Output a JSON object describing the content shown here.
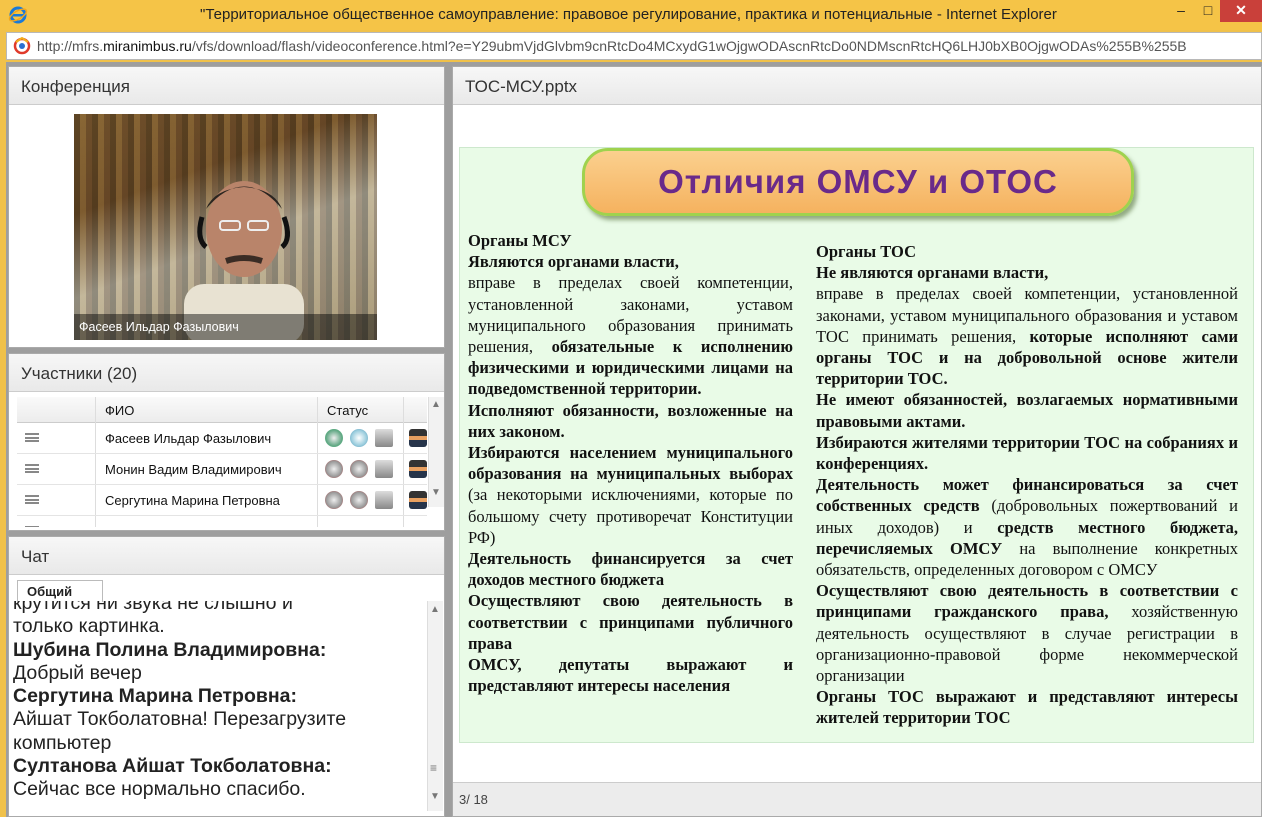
{
  "window": {
    "title": "\"Территориальное общественное самоуправление: правовое регулирование, практика и потенциальные  - Internet Explorer",
    "minimize": "–",
    "maximize": "□",
    "close": "✕"
  },
  "address": {
    "url_prefix": "http://mfrs.",
    "url_host": "miranimbus.ru",
    "url_suffix": "/vfs/download/flash/videoconference.html?e=Y29ubmVjdGlvbm9cnRtcDo4MCxydG1wOjgwODAscnRtcDo0NDMscnRtcHQ6LHJ0bXB0OjgwODAs%255B%255B"
  },
  "conference": {
    "title": "Конференция",
    "speaker_name": "Фасеев Ильдар Фазылович"
  },
  "participants": {
    "title": "Участники (20)",
    "col_name": "ФИО",
    "col_status": "Статус",
    "rows": [
      {
        "name": "Фасеев Ильдар Фазылович"
      },
      {
        "name": "Монин Вадим Владимирович"
      },
      {
        "name": "Сергутина Марина Петровна"
      }
    ]
  },
  "chat": {
    "title": "Чат",
    "tab": "Общий",
    "lines": [
      {
        "text": "крутится ни звука не слышно и",
        "author": false
      },
      {
        "text": "только картинка.",
        "author": false
      },
      {
        "text": "Шубина Полина Владимировна:",
        "author": true
      },
      {
        "text": "Добрый вечер",
        "author": false
      },
      {
        "text": "Сергутина Марина Петровна:",
        "author": true
      },
      {
        "text": "Айшат Токболатовна! Перезагрузите",
        "author": false
      },
      {
        "text": "компьютер",
        "author": false
      },
      {
        "text": "Султанова Айшат  Токболатовна:",
        "author": true
      },
      {
        "text": "Сейчас все нормально спасибо.",
        "author": false
      }
    ]
  },
  "slide": {
    "file": "ТОС-МСУ.pptx",
    "banner": "Отличия ОМСУ и ОТОС",
    "left": {
      "heading": "Органы МСУ",
      "p1_bold": "Являются органами власти,",
      "p1_text": "вправе в пределах своей компетенции, установленной законами, уставом муниципального образования принимать решения,",
      "p1_bold2": "обязательные к исполнению физическими и юридическими лицами на подведомственной территории.",
      "p2": "Исполняют обязанности, возложенные на них законом.",
      "p3_bold": "Избираются населением муниципального образования на муниципальных выборах",
      "p3_text": "(за некоторыми исключениями, которые по большому счету противоречат Конституции РФ)",
      "p4": "Деятельность финансируется за счет доходов местного бюджета",
      "p5": "Осуществляют свою деятельность в соответствии с принципами публичного права",
      "p6": "ОМСУ, депутаты выражают и представляют интересы населения"
    },
    "right": {
      "heading": "Органы ТОС",
      "p1_bold": "Не являются органами власти,",
      "p1_text": "вправе в пределах своей компетенции, установленной законами, уставом муниципального образования и уставом ТОС принимать решения,",
      "p1_bold2": "которые исполняют сами органы ТОС и на добровольной основе жители территории ТОС.",
      "p2": "Не имеют обязанностей, возлагаемых нормативными правовыми актами.",
      "p3": "Избираются жителями территории ТОС на собраниях и конференциях.",
      "p4_bold": "Деятельность может финансироваться за счет собственных средств",
      "p4_text": "(добровольных пожертвований и иных доходов) и",
      "p4_bold2": "средств местного бюджета, перечисляемых ОМСУ",
      "p4_text2": "на выполнение конкретных обязательств, определенных договором с ОМСУ",
      "p5_bold": "Осуществляют свою деятельность в соответствии с принципами гражданского права,",
      "p5_text": "хозяйственную деятельность осуществляют в случае регистрации в организационно-правовой форме некоммерческой организации",
      "p6": "Органы ТОС выражают и представляют интересы жителей территории ТОС"
    },
    "page": "3/ 18"
  }
}
